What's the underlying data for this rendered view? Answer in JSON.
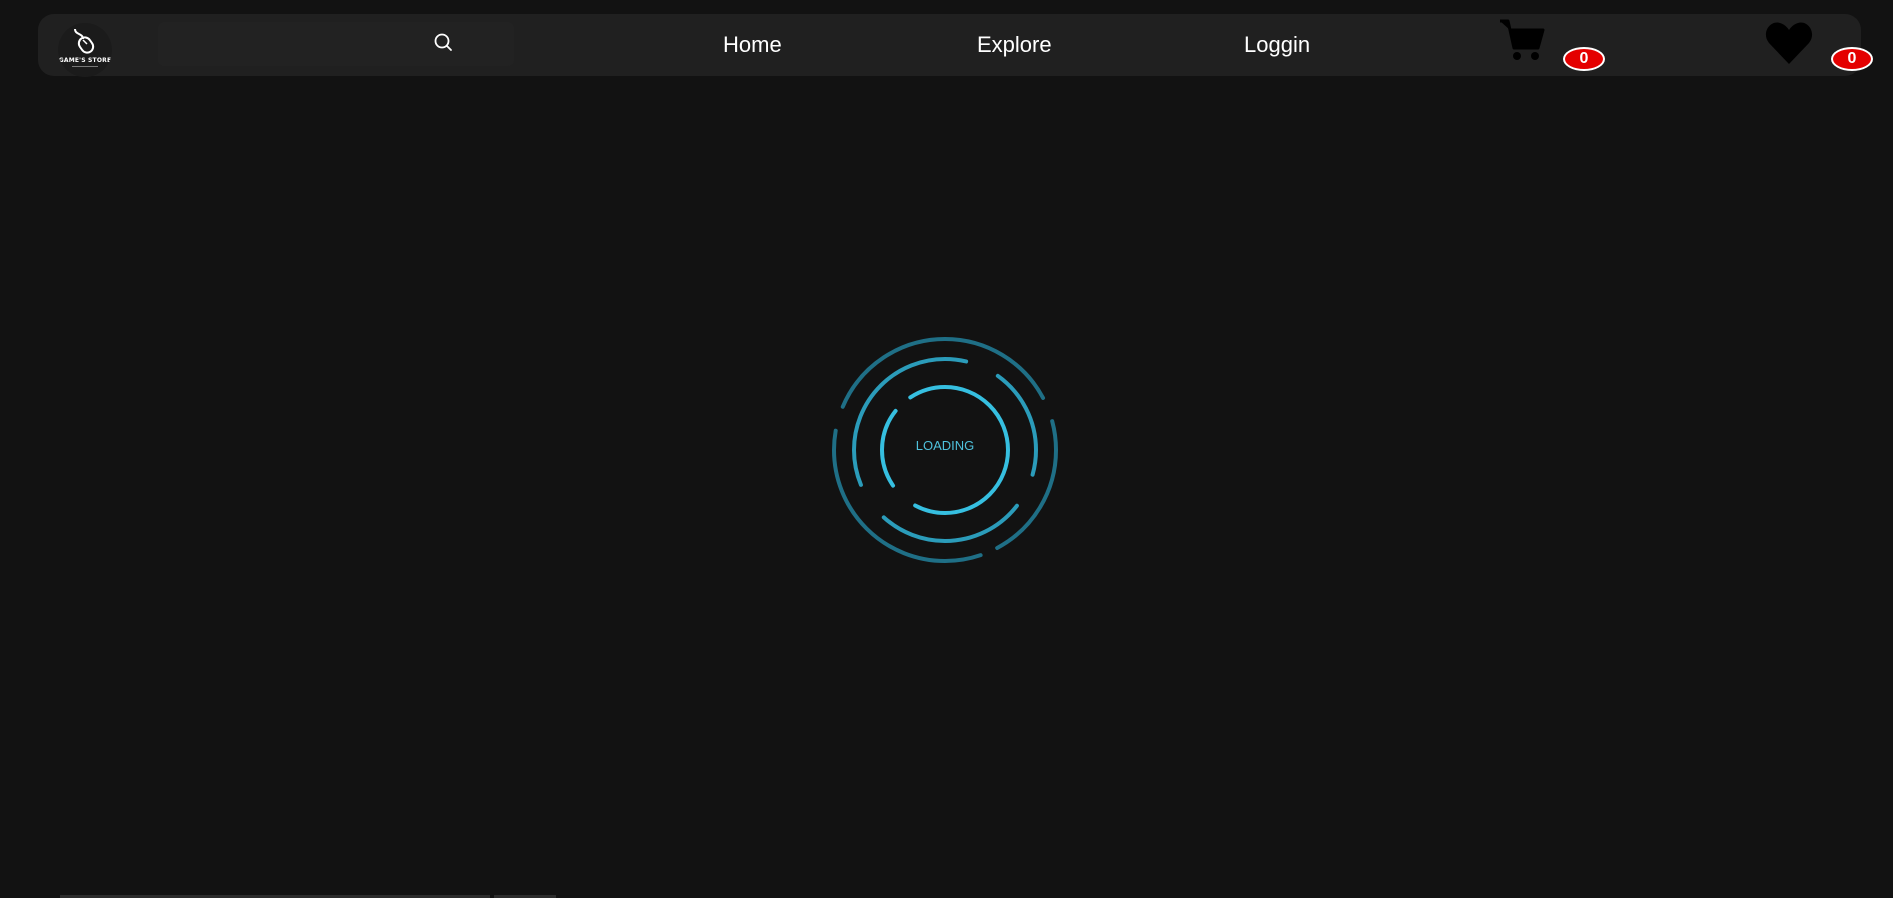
{
  "brand": {
    "logo_text": "GAME'S STORE"
  },
  "nav": {
    "search_icon": "search-icon",
    "links": [
      {
        "label": "Home"
      },
      {
        "label": "Explore"
      },
      {
        "label": "Loggin"
      }
    ],
    "cart": {
      "icon": "cart-icon",
      "count": "0"
    },
    "wishlist": {
      "icon": "heart-icon",
      "count": "0"
    }
  },
  "loader": {
    "text": "LOADING"
  },
  "colors": {
    "background": "#121212",
    "navbar": "#202020",
    "loader_accent": "#2fb4d6",
    "badge": "#e40000"
  }
}
